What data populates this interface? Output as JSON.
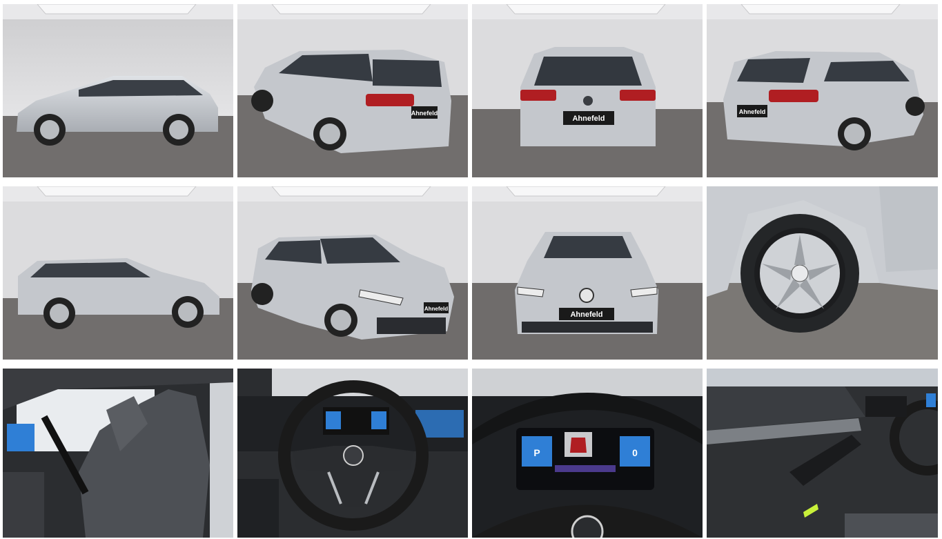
{
  "gallery": {
    "dealer_plate": "Ahnefeld",
    "cluster": {
      "gear": "P",
      "speed": "0"
    },
    "photos": [
      {
        "view": "side-left"
      },
      {
        "view": "rear-left-three-quarter"
      },
      {
        "view": "rear"
      },
      {
        "view": "rear-right-three-quarter"
      },
      {
        "view": "side-right"
      },
      {
        "view": "front-left-three-quarter"
      },
      {
        "view": "front"
      },
      {
        "view": "wheel-detail"
      },
      {
        "view": "interior-front-seats"
      },
      {
        "view": "cockpit-steering-wheel"
      },
      {
        "view": "instrument-cluster"
      },
      {
        "view": "door-panel"
      }
    ]
  },
  "colors": {
    "studio_wall": "#dcdcde",
    "studio_floor": "#6f6c6b",
    "car_silver": "#c4c7cc",
    "interior_dark": "#2b2d30",
    "taillight": "#b01e22",
    "screen_blue": "#2f7fd6"
  }
}
